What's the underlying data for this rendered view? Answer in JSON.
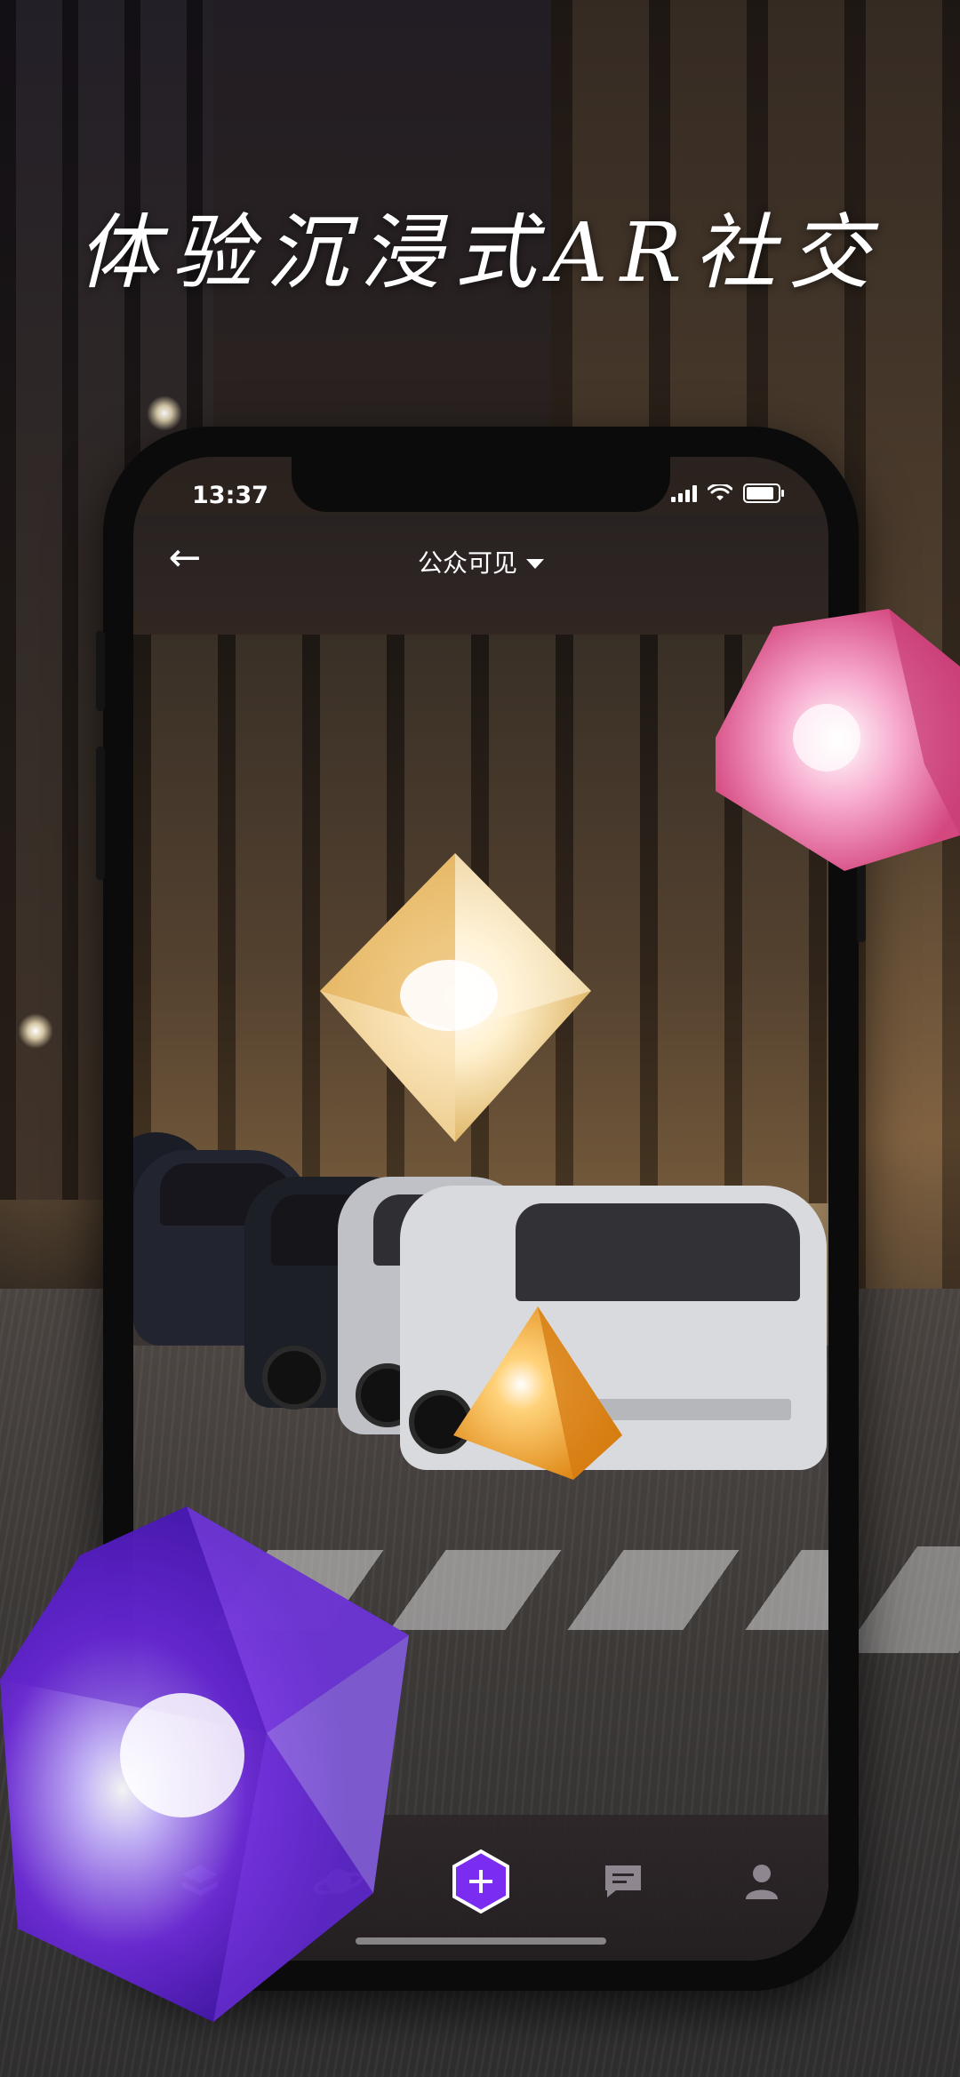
{
  "headline": "体验沉浸式AR社交",
  "status_bar": {
    "time": "13:37"
  },
  "nav": {
    "back_label": "←",
    "visibility_label": "公众可见"
  },
  "tabs": [
    {
      "icon": "layers-icon",
      "label": "layers"
    },
    {
      "icon": "planet-icon",
      "label": "explore"
    },
    {
      "icon": "hexagon-add-icon",
      "label": "create"
    },
    {
      "icon": "chat-icon",
      "label": "messages"
    },
    {
      "icon": "profile-icon",
      "label": "profile"
    }
  ],
  "colors": {
    "accent_purple": "#7a2cf0",
    "gem_gold": "#f2d9a8",
    "gem_orange": "#f0a030",
    "gem_pink": "#f08ab8",
    "gem_violet": "#7c3ae0"
  }
}
